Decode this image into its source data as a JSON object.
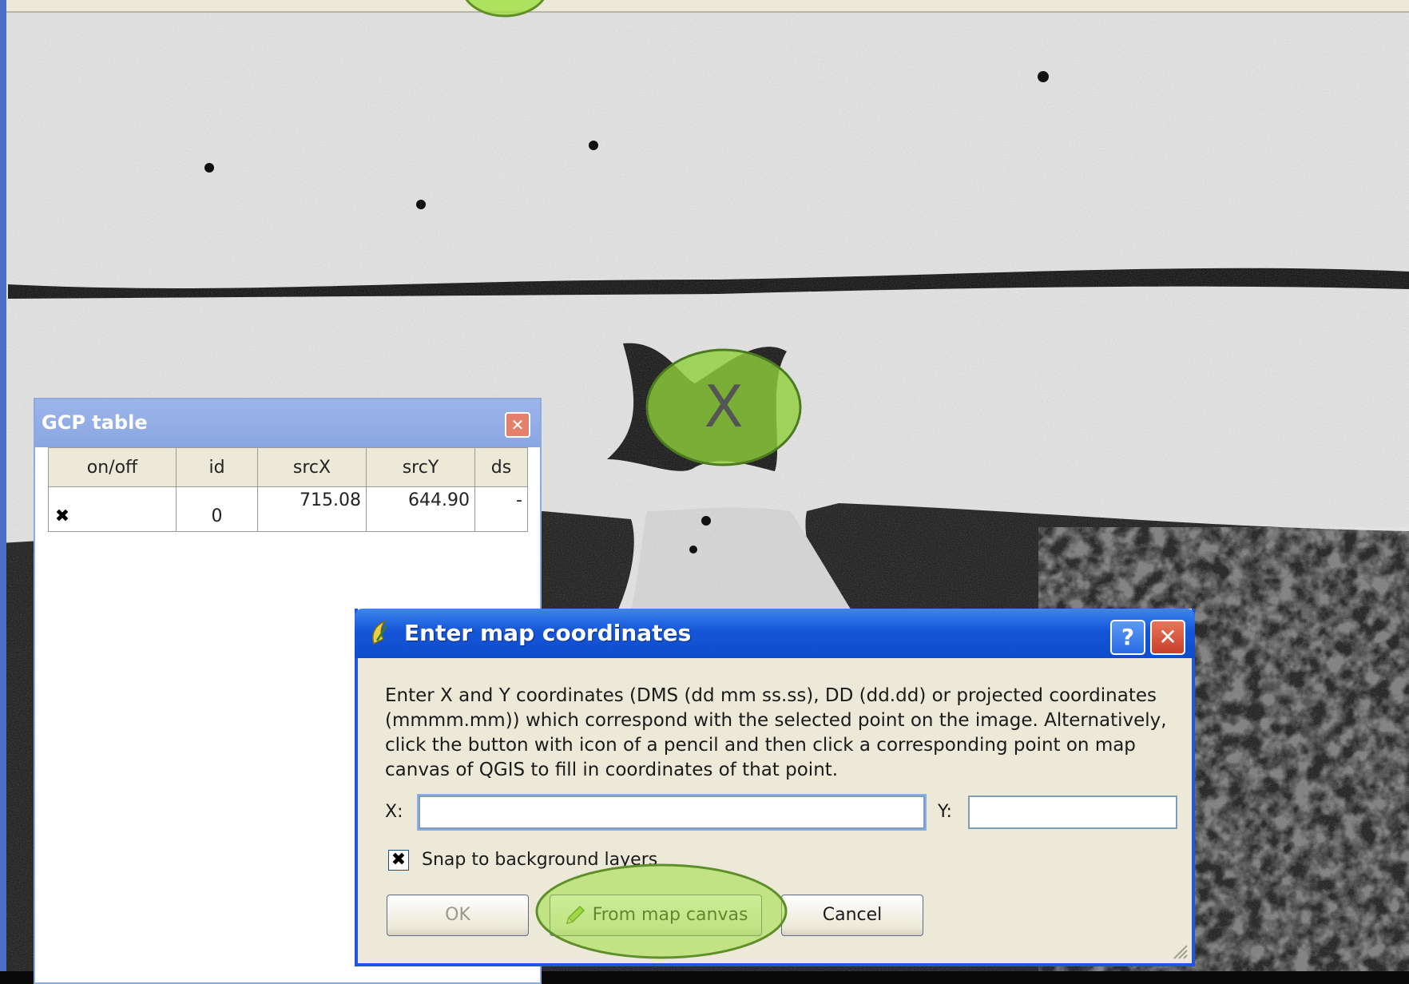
{
  "gcp_table": {
    "title": "GCP table",
    "columns": [
      "on/off",
      "id",
      "srcX",
      "srcY",
      "ds"
    ],
    "rows": [
      {
        "onoff": "✖",
        "id": "0",
        "srcX": "715.08",
        "srcY": "644.90",
        "dst": "-"
      }
    ],
    "close_glyph": "✕"
  },
  "dialog": {
    "title": "Enter map coordinates",
    "help_glyph": "?",
    "close_glyph": "✕",
    "description": "Enter X and Y coordinates (DMS (dd mm ss.ss), DD (dd.dd) or projected coordinates (mmmm.mm)) which correspond with the selected point on the image. Alternatively, click the button with icon of a pencil and then click a corresponding point on map canvas of QGIS to fill in coordinates of that point.",
    "x_label": "X:",
    "x_value": "",
    "y_label": "Y:",
    "y_value": "",
    "snap_label": "Snap to background layers",
    "snap_checked": true,
    "snap_glyph": "✖",
    "ok_label": "OK",
    "from_map_label": "From map canvas",
    "cancel_label": "Cancel"
  },
  "map": {
    "marker_glyph": "X"
  },
  "icons": {
    "app": "qgis-icon",
    "pencil": "pencil-icon",
    "help": "help-icon",
    "close": "close-icon"
  },
  "colors": {
    "highlight_green": "#9fdf3f",
    "titlebar_blue": "#1556d8",
    "gcp_titlebar": "#9cb6ea"
  }
}
